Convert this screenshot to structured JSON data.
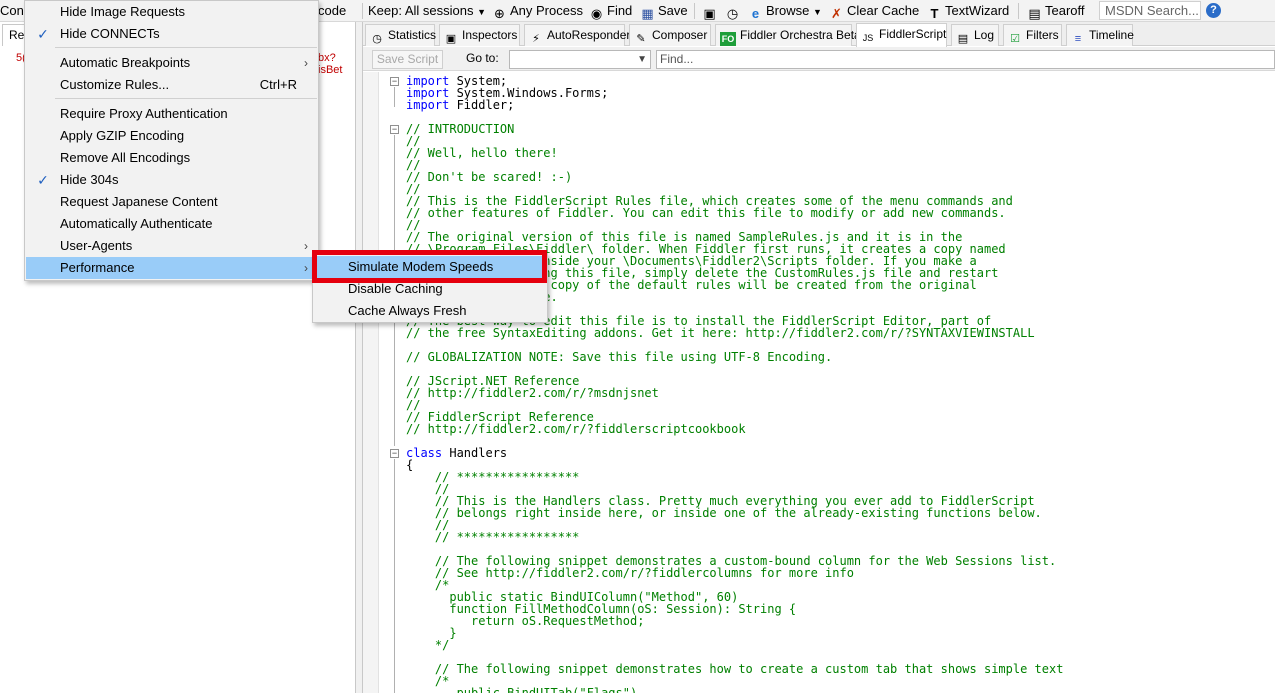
{
  "toolbar": {
    "config_partial": "Conf",
    "decode_partial": "code",
    "keep_sessions": "Keep: All sessions",
    "any_process": "Any Process",
    "find": "Find",
    "save": "Save",
    "browse": "Browse",
    "clear_cache": "Clear Cache",
    "text_wizard": "TextWizard",
    "tearoff": "Tearoff",
    "msdn_search": "MSDN Search..."
  },
  "left_pane": {
    "tab_partial": "Re",
    "row_num_partial": "5(",
    "row_url_partial": "bx?isBet"
  },
  "tabs": [
    {
      "label": "Statistics",
      "icon": "statistics-icon"
    },
    {
      "label": "Inspectors",
      "icon": "inspectors-icon"
    },
    {
      "label": "AutoResponder",
      "icon": "autoresponder-icon"
    },
    {
      "label": "Composer",
      "icon": "composer-icon"
    },
    {
      "label": "Fiddler Orchestra Beta",
      "icon": "fo-icon",
      "badge": "FO"
    },
    {
      "label": "FiddlerScript",
      "icon": "script-icon",
      "active": true
    },
    {
      "label": "Log",
      "icon": "log-icon"
    },
    {
      "label": "Filters",
      "icon": "filters-icon"
    },
    {
      "label": "Timeline",
      "icon": "timeline-icon"
    }
  ],
  "script_bar": {
    "save_script": "Save Script",
    "goto_label": "Go to:",
    "goto_value": "",
    "find_placeholder": "Find..."
  },
  "code_lines": [
    {
      "t": "kw",
      "s": "import",
      "r": " System;"
    },
    {
      "t": "kw",
      "s": "import",
      "r": " System.Windows.Forms;"
    },
    {
      "t": "kw",
      "s": "import",
      "r": " Fiddler;"
    },
    {
      "t": "pl",
      "s": ""
    },
    {
      "t": "cm",
      "s": "// INTRODUCTION"
    },
    {
      "t": "cm",
      "s": "//"
    },
    {
      "t": "cm",
      "s": "// Well, hello there!"
    },
    {
      "t": "cm",
      "s": "//"
    },
    {
      "t": "cm",
      "s": "// Don't be scared! :-)"
    },
    {
      "t": "cm",
      "s": "//"
    },
    {
      "t": "cm",
      "s": "// This is the FiddlerScript Rules file, which creates some of the menu commands and"
    },
    {
      "t": "cm",
      "s": "// other features of Fiddler. You can edit this file to modify or add new commands."
    },
    {
      "t": "cm",
      "s": "//"
    },
    {
      "t": "cm",
      "s": "// The original version of this file is named SampleRules.js and it is in the"
    },
    {
      "t": "cm",
      "s": "// \\Program Files\\Fiddler\\ folder. When Fiddler first runs, it creates a copy named"
    },
    {
      "t": "cm",
      "s": "// CustomRules.js inside your \\Documents\\Fiddler2\\Scripts folder. If you make a"
    },
    {
      "t": "cm",
      "s": "// mistake in editing this file, simply delete the CustomRules.js file and restart"
    },
    {
      "t": "cm",
      "s": "// Fiddler. A fresh copy of the default rules will be created from the original"
    },
    {
      "t": "cm",
      "s": "// sample rules file."
    },
    {
      "t": "pl",
      "s": ""
    },
    {
      "t": "cm",
      "s": "// The best way to edit this file is to install the FiddlerScript Editor, part of"
    },
    {
      "t": "cm",
      "s": "// the free SyntaxEditing addons. Get it here: http://fiddler2.com/r/?SYNTAXVIEWINSTALL"
    },
    {
      "t": "pl",
      "s": ""
    },
    {
      "t": "cm",
      "s": "// GLOBALIZATION NOTE: Save this file using UTF-8 Encoding."
    },
    {
      "t": "pl",
      "s": ""
    },
    {
      "t": "cm",
      "s": "// JScript.NET Reference"
    },
    {
      "t": "cm",
      "s": "// http://fiddler2.com/r/?msdnjsnet"
    },
    {
      "t": "cm",
      "s": "//"
    },
    {
      "t": "cm",
      "s": "// FiddlerScript Reference"
    },
    {
      "t": "cm",
      "s": "// http://fiddler2.com/r/?fiddlerscriptcookbook"
    },
    {
      "t": "pl",
      "s": ""
    },
    {
      "t": "kw",
      "s": "class",
      "r": " Handlers"
    },
    {
      "t": "pl",
      "s": "{"
    },
    {
      "t": "cm",
      "s": "    // *****************"
    },
    {
      "t": "cm",
      "s": "    //"
    },
    {
      "t": "cm",
      "s": "    // This is the Handlers class. Pretty much everything you ever add to FiddlerScript"
    },
    {
      "t": "cm",
      "s": "    // belongs right inside here, or inside one of the already-existing functions below."
    },
    {
      "t": "cm",
      "s": "    //"
    },
    {
      "t": "cm",
      "s": "    // *****************"
    },
    {
      "t": "pl",
      "s": ""
    },
    {
      "t": "cm",
      "s": "    // The following snippet demonstrates a custom-bound column for the Web Sessions list."
    },
    {
      "t": "cm",
      "s": "    // See http://fiddler2.com/r/?fiddlercolumns for more info"
    },
    {
      "t": "cm",
      "s": "    /*"
    },
    {
      "t": "cm",
      "s": "      public static BindUIColumn(\"Method\", 60)"
    },
    {
      "t": "cm",
      "s": "      function FillMethodColumn(oS: Session): String {"
    },
    {
      "t": "cm",
      "s": "         return oS.RequestMethod;"
    },
    {
      "t": "cm",
      "s": "      }"
    },
    {
      "t": "cm",
      "s": "    */"
    },
    {
      "t": "pl",
      "s": ""
    },
    {
      "t": "cm",
      "s": "    // The following snippet demonstrates how to create a custom tab that shows simple text"
    },
    {
      "t": "cm",
      "s": "    /*"
    },
    {
      "t": "cm",
      "s": "       public BindUITab(\"Flags\")"
    }
  ],
  "rules_menu": {
    "items": [
      {
        "label": "Hide Image Requests",
        "checked": false
      },
      {
        "label": "Hide CONNECTs",
        "checked": true
      },
      {
        "label": "Automatic Breakpoints",
        "submenu": true
      },
      {
        "label": "Customize Rules...",
        "shortcut": "Ctrl+R"
      },
      {
        "label": "Require Proxy Authentication"
      },
      {
        "label": "Apply GZIP Encoding"
      },
      {
        "label": "Remove All Encodings"
      },
      {
        "label": "Hide 304s",
        "checked": true
      },
      {
        "label": "Request Japanese Content"
      },
      {
        "label": "Automatically Authenticate"
      },
      {
        "label": "User-Agents",
        "submenu": true
      },
      {
        "label": "Performance",
        "submenu": true,
        "highlighted": true
      }
    ]
  },
  "performance_menu": {
    "items": [
      {
        "label": "Simulate Modem Speeds",
        "highlighted": true
      },
      {
        "label": "Disable Caching"
      },
      {
        "label": "Cache Always Fresh"
      }
    ]
  },
  "colors": {
    "menu_highlight": "#99ccf8",
    "annotation_red": "#e5000e",
    "code_keyword": "#0000ff",
    "code_comment": "#008000"
  }
}
